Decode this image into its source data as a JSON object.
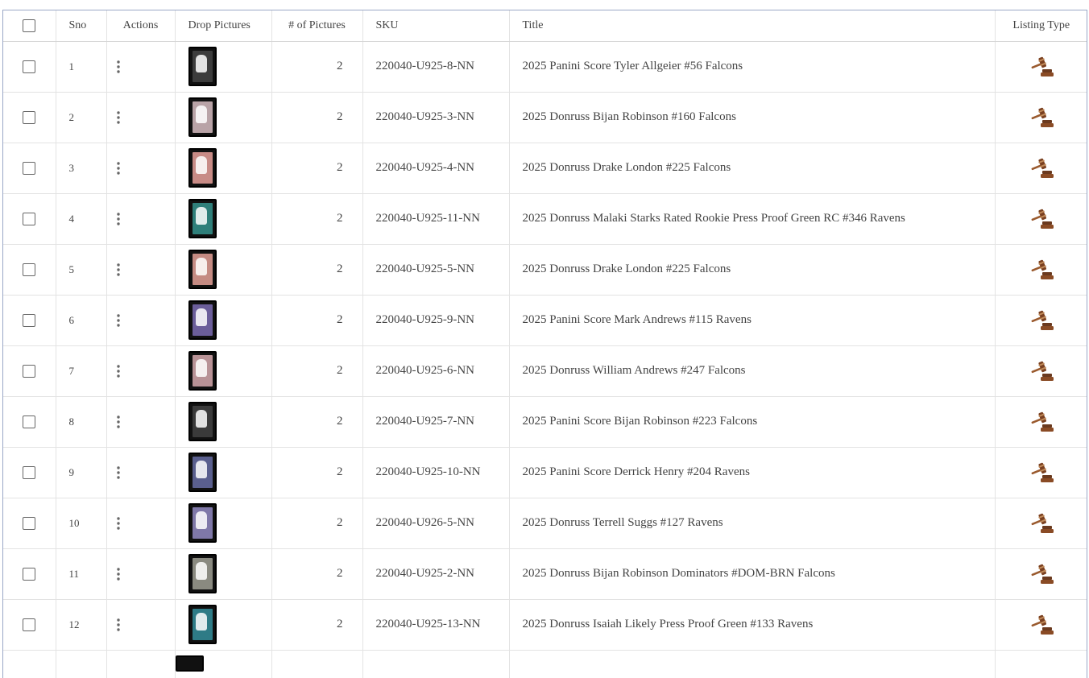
{
  "columns": {
    "sno": "Sno",
    "actions": "Actions",
    "drop_pictures": "Drop Pictures",
    "num_pictures": "# of Pictures",
    "sku": "SKU",
    "title": "Title",
    "listing_type": "Listing Type"
  },
  "listing_type_icon": "auction-gavel-icon",
  "rows": [
    {
      "sno": "1",
      "pictures": "2",
      "sku": "220040-U925-8-NN",
      "title": "2025 Panini Score Tyler Allgeier #56 Falcons",
      "thumb_color": "#3c3c3c"
    },
    {
      "sno": "2",
      "pictures": "2",
      "sku": "220040-U925-3-NN",
      "title": "2025 Donruss Bijan Robinson #160 Falcons",
      "thumb_color": "#b9a3a7"
    },
    {
      "sno": "3",
      "pictures": "2",
      "sku": "220040-U925-4-NN",
      "title": "2025 Donruss Drake London #225 Falcons",
      "thumb_color": "#c88b86"
    },
    {
      "sno": "4",
      "pictures": "2",
      "sku": "220040-U925-11-NN",
      "title": "2025 Donruss Malaki Starks Rated Rookie Press Proof Green RC #346 Ravens",
      "thumb_color": "#2f7f7a"
    },
    {
      "sno": "5",
      "pictures": "2",
      "sku": "220040-U925-5-NN",
      "title": "2025 Donruss Drake London #225 Falcons",
      "thumb_color": "#c58b83"
    },
    {
      "sno": "6",
      "pictures": "2",
      "sku": "220040-U925-9-NN",
      "title": "2025 Panini Score Mark Andrews #115 Ravens",
      "thumb_color": "#6b5e9a"
    },
    {
      "sno": "7",
      "pictures": "2",
      "sku": "220040-U925-6-NN",
      "title": "2025 Donruss William Andrews #247 Falcons",
      "thumb_color": "#b89296"
    },
    {
      "sno": "8",
      "pictures": "2",
      "sku": "220040-U925-7-NN",
      "title": "2025 Panini Score Bijan Robinson #223 Falcons",
      "thumb_color": "#3a3a3a"
    },
    {
      "sno": "9",
      "pictures": "2",
      "sku": "220040-U925-10-NN",
      "title": "2025 Panini Score Derrick Henry #204 Ravens",
      "thumb_color": "#5a5f8e"
    },
    {
      "sno": "10",
      "pictures": "2",
      "sku": "220040-U926-5-NN",
      "title": "2025 Donruss Terrell Suggs #127 Ravens",
      "thumb_color": "#7f78a8"
    },
    {
      "sno": "11",
      "pictures": "2",
      "sku": "220040-U925-2-NN",
      "title": "2025 Donruss Bijan Robinson Dominators #DOM-BRN Falcons",
      "thumb_color": "#8a8a80"
    },
    {
      "sno": "12",
      "pictures": "2",
      "sku": "220040-U925-13-NN",
      "title": "2025 Donruss Isaiah Likely Press Proof Green #133 Ravens",
      "thumb_color": "#2e7b86"
    }
  ]
}
